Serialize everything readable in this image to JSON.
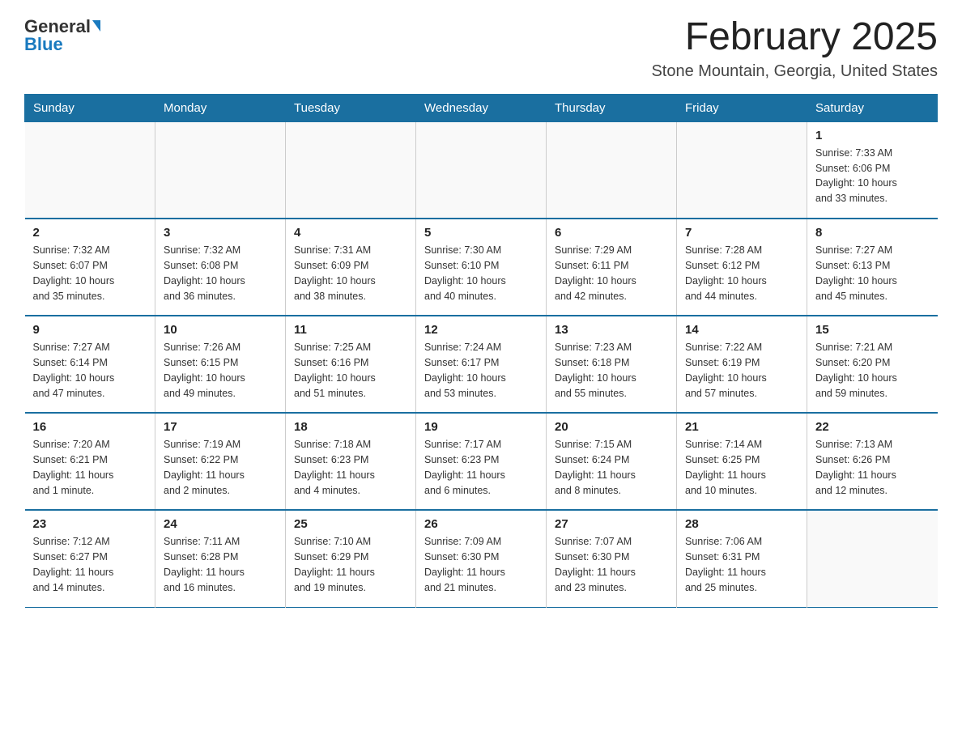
{
  "logo": {
    "general": "General",
    "blue": "Blue"
  },
  "header": {
    "month_year": "February 2025",
    "location": "Stone Mountain, Georgia, United States"
  },
  "days_of_week": [
    "Sunday",
    "Monday",
    "Tuesday",
    "Wednesday",
    "Thursday",
    "Friday",
    "Saturday"
  ],
  "weeks": [
    [
      {
        "day": "",
        "info": ""
      },
      {
        "day": "",
        "info": ""
      },
      {
        "day": "",
        "info": ""
      },
      {
        "day": "",
        "info": ""
      },
      {
        "day": "",
        "info": ""
      },
      {
        "day": "",
        "info": ""
      },
      {
        "day": "1",
        "info": "Sunrise: 7:33 AM\nSunset: 6:06 PM\nDaylight: 10 hours\nand 33 minutes."
      }
    ],
    [
      {
        "day": "2",
        "info": "Sunrise: 7:32 AM\nSunset: 6:07 PM\nDaylight: 10 hours\nand 35 minutes."
      },
      {
        "day": "3",
        "info": "Sunrise: 7:32 AM\nSunset: 6:08 PM\nDaylight: 10 hours\nand 36 minutes."
      },
      {
        "day": "4",
        "info": "Sunrise: 7:31 AM\nSunset: 6:09 PM\nDaylight: 10 hours\nand 38 minutes."
      },
      {
        "day": "5",
        "info": "Sunrise: 7:30 AM\nSunset: 6:10 PM\nDaylight: 10 hours\nand 40 minutes."
      },
      {
        "day": "6",
        "info": "Sunrise: 7:29 AM\nSunset: 6:11 PM\nDaylight: 10 hours\nand 42 minutes."
      },
      {
        "day": "7",
        "info": "Sunrise: 7:28 AM\nSunset: 6:12 PM\nDaylight: 10 hours\nand 44 minutes."
      },
      {
        "day": "8",
        "info": "Sunrise: 7:27 AM\nSunset: 6:13 PM\nDaylight: 10 hours\nand 45 minutes."
      }
    ],
    [
      {
        "day": "9",
        "info": "Sunrise: 7:27 AM\nSunset: 6:14 PM\nDaylight: 10 hours\nand 47 minutes."
      },
      {
        "day": "10",
        "info": "Sunrise: 7:26 AM\nSunset: 6:15 PM\nDaylight: 10 hours\nand 49 minutes."
      },
      {
        "day": "11",
        "info": "Sunrise: 7:25 AM\nSunset: 6:16 PM\nDaylight: 10 hours\nand 51 minutes."
      },
      {
        "day": "12",
        "info": "Sunrise: 7:24 AM\nSunset: 6:17 PM\nDaylight: 10 hours\nand 53 minutes."
      },
      {
        "day": "13",
        "info": "Sunrise: 7:23 AM\nSunset: 6:18 PM\nDaylight: 10 hours\nand 55 minutes."
      },
      {
        "day": "14",
        "info": "Sunrise: 7:22 AM\nSunset: 6:19 PM\nDaylight: 10 hours\nand 57 minutes."
      },
      {
        "day": "15",
        "info": "Sunrise: 7:21 AM\nSunset: 6:20 PM\nDaylight: 10 hours\nand 59 minutes."
      }
    ],
    [
      {
        "day": "16",
        "info": "Sunrise: 7:20 AM\nSunset: 6:21 PM\nDaylight: 11 hours\nand 1 minute."
      },
      {
        "day": "17",
        "info": "Sunrise: 7:19 AM\nSunset: 6:22 PM\nDaylight: 11 hours\nand 2 minutes."
      },
      {
        "day": "18",
        "info": "Sunrise: 7:18 AM\nSunset: 6:23 PM\nDaylight: 11 hours\nand 4 minutes."
      },
      {
        "day": "19",
        "info": "Sunrise: 7:17 AM\nSunset: 6:23 PM\nDaylight: 11 hours\nand 6 minutes."
      },
      {
        "day": "20",
        "info": "Sunrise: 7:15 AM\nSunset: 6:24 PM\nDaylight: 11 hours\nand 8 minutes."
      },
      {
        "day": "21",
        "info": "Sunrise: 7:14 AM\nSunset: 6:25 PM\nDaylight: 11 hours\nand 10 minutes."
      },
      {
        "day": "22",
        "info": "Sunrise: 7:13 AM\nSunset: 6:26 PM\nDaylight: 11 hours\nand 12 minutes."
      }
    ],
    [
      {
        "day": "23",
        "info": "Sunrise: 7:12 AM\nSunset: 6:27 PM\nDaylight: 11 hours\nand 14 minutes."
      },
      {
        "day": "24",
        "info": "Sunrise: 7:11 AM\nSunset: 6:28 PM\nDaylight: 11 hours\nand 16 minutes."
      },
      {
        "day": "25",
        "info": "Sunrise: 7:10 AM\nSunset: 6:29 PM\nDaylight: 11 hours\nand 19 minutes."
      },
      {
        "day": "26",
        "info": "Sunrise: 7:09 AM\nSunset: 6:30 PM\nDaylight: 11 hours\nand 21 minutes."
      },
      {
        "day": "27",
        "info": "Sunrise: 7:07 AM\nSunset: 6:30 PM\nDaylight: 11 hours\nand 23 minutes."
      },
      {
        "day": "28",
        "info": "Sunrise: 7:06 AM\nSunset: 6:31 PM\nDaylight: 11 hours\nand 25 minutes."
      },
      {
        "day": "",
        "info": ""
      }
    ]
  ]
}
